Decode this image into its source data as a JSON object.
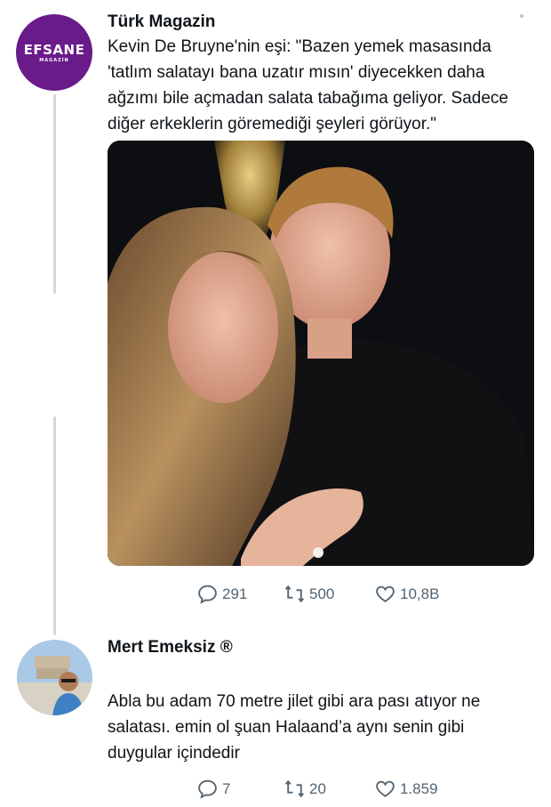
{
  "tweet": {
    "avatar": {
      "text": "EFSANE",
      "subtext": "MAGAZİN",
      "bg": "#6a1b8a"
    },
    "author": "Türk Magazin",
    "lines": [
      "Kevin De Bruyne'nin eşi: \"Bazen yemek masasında",
      "'tatlım salatayı bana uzatır mısın' diyecekken daha",
      "ağzımı bile açmadan salata tabağıma geliyor. Sadece",
      "diğer erkeklerin göremediği şeyleri görüyor.\""
    ],
    "stats": {
      "replies": "291",
      "retweets": "500",
      "likes": "10,8B"
    }
  },
  "reply": {
    "author": "Mert Emeksiz ®",
    "lines": [
      "Abla bu adam 70 metre jilet gibi ara pası atıyor ne",
      "salatası. emin ol şuan Halaand’a aynı senin gibi",
      "duygular içindedir"
    ],
    "stats": {
      "replies": "7",
      "retweets": "20",
      "likes": "1.859"
    }
  },
  "icons": {
    "reply": "reply-icon",
    "retweet": "retweet-icon",
    "like": "like-icon",
    "more": "more-icon"
  },
  "colors": {
    "text": "#0f1419",
    "muted": "#536471",
    "line": "#cfd9de",
    "brand": "#6a1b8a"
  }
}
